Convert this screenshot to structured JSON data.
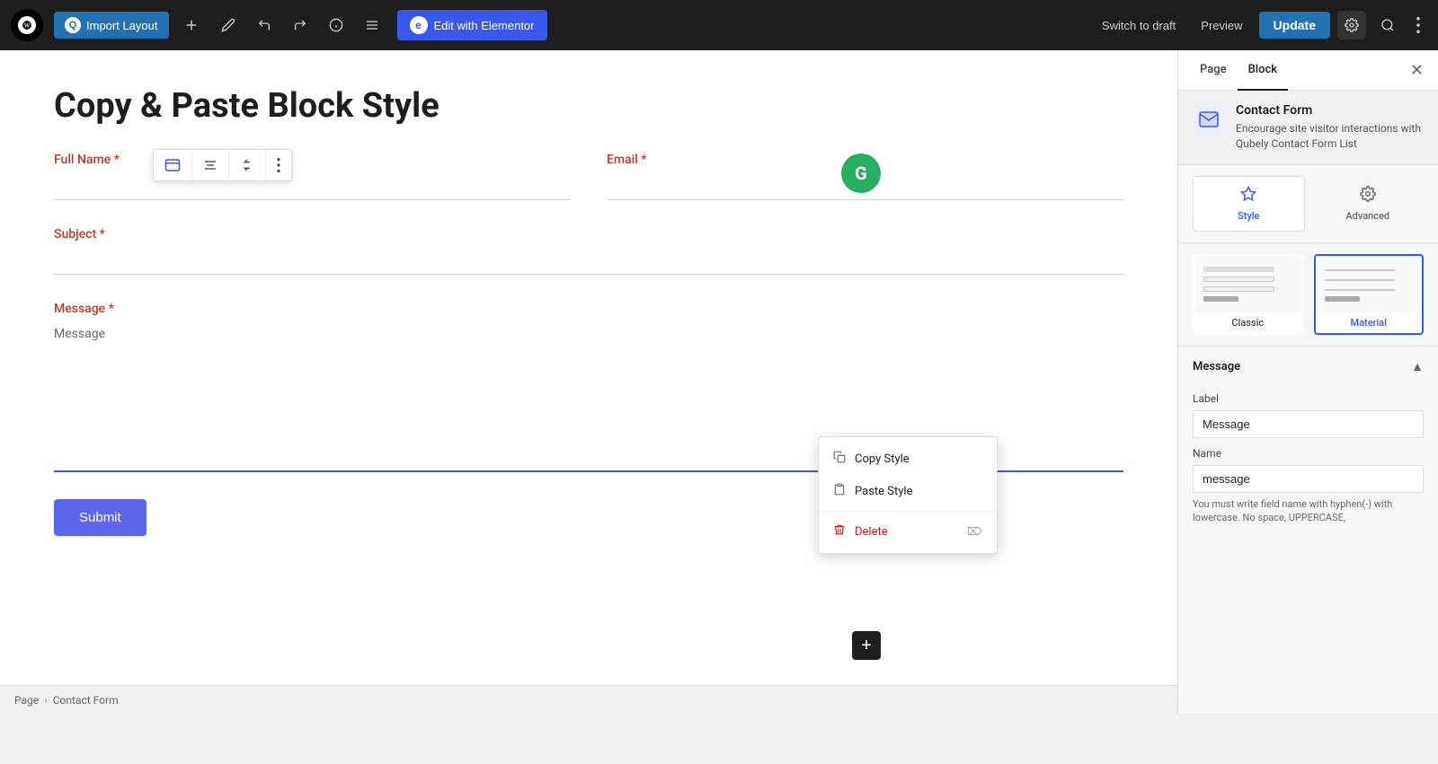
{
  "topbar": {
    "import_label": "Import Layout",
    "elementor_label": "Edit with Elementor",
    "switch_draft_label": "Switch to draft",
    "preview_label": "Preview",
    "update_label": "Update"
  },
  "breadcrumb": {
    "page_label": "Page",
    "separator": "›",
    "current_label": "Contact Form"
  },
  "page": {
    "title": "Copy & Paste Block Style"
  },
  "form": {
    "full_name_label": "Full Name *",
    "email_label": "Email *",
    "subject_label": "Subject *",
    "message_label": "Message *",
    "message_placeholder": "Message",
    "submit_label": "Submit"
  },
  "context_menu": {
    "copy_style_label": "Copy Style",
    "paste_style_label": "Paste Style",
    "delete_label": "Delete"
  },
  "sidebar": {
    "tab_page_label": "Page",
    "tab_block_label": "Block",
    "block_info_title": "Contact Form",
    "block_info_desc": "Encourage site visitor interactions with Qubely Contact Form List",
    "style_tab_label": "Style",
    "advanced_tab_label": "Advanced",
    "classic_label": "Classic",
    "material_label": "Material",
    "message_section_title": "Message",
    "label_field_label": "Label",
    "label_field_value": "Message",
    "name_field_label": "Name",
    "name_field_value": "message",
    "name_field_hint": "You must write field name with hyphen(-) with lowercase. No space, UPPERCASE,"
  }
}
